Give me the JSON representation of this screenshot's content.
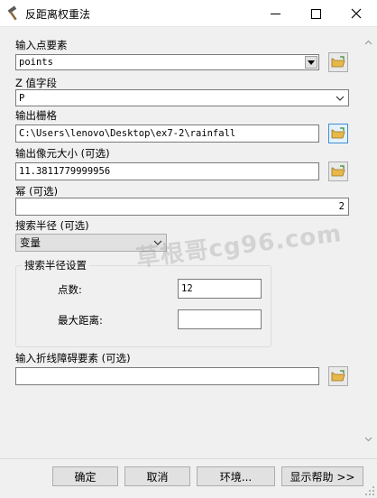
{
  "window": {
    "title": "反距离权重法",
    "app_icon": "hammer-icon",
    "minimize_icon": "minimize-icon",
    "maximize_icon": "maximize-icon",
    "close_icon": "close-icon"
  },
  "form": {
    "input_points": {
      "label": "输入点要素",
      "value": "points"
    },
    "z_field": {
      "label": "Z 值字段",
      "value": "P"
    },
    "output_raster": {
      "label": "输出栅格",
      "value": "C:\\Users\\lenovo\\Desktop\\ex7-2\\rainfall"
    },
    "cell_size": {
      "label": "输出像元大小 (可选)",
      "value": "11.3811779999956"
    },
    "power": {
      "label": "幂 (可选)",
      "value": "2"
    },
    "search_radius": {
      "label": "搜索半径 (可选)",
      "type_value": "变量",
      "group_title": "搜索半径设置",
      "point_count_label": "点数:",
      "point_count_value": "12",
      "max_distance_label": "最大距离:",
      "max_distance_value": ""
    },
    "barrier": {
      "label": "输入折线障碍要素 (可选)",
      "value": ""
    }
  },
  "watermark": "草根哥cg96.com",
  "buttons": {
    "ok": "确定",
    "cancel": "取消",
    "environments": "环境...",
    "show_help": "显示帮助 >>"
  },
  "icons": {
    "folder": "open-folder-icon",
    "dropdown": "chevron-down-icon"
  }
}
